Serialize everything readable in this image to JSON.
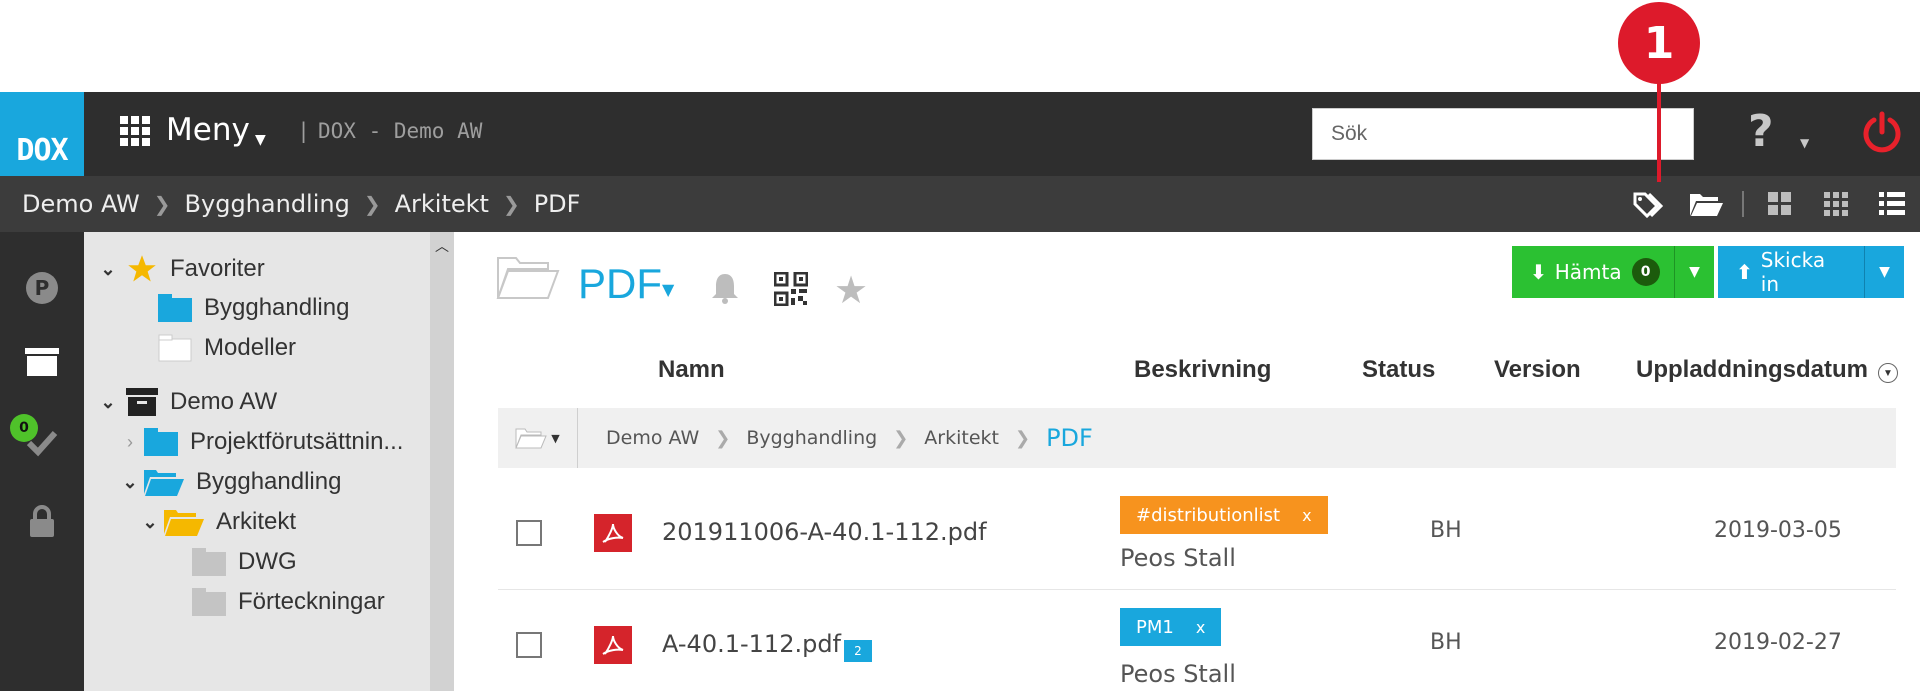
{
  "callout": {
    "number": "1"
  },
  "header": {
    "logo": "DOX",
    "menu_label": "Meny",
    "separator": "|",
    "site_title": "DOX - Demo AW",
    "search_placeholder": "Sök",
    "help_symbol": "?"
  },
  "breadcrumb": [
    "Demo AW",
    "Bygghandling",
    "Arkitekt",
    "PDF"
  ],
  "rail": {
    "task_badge": "0"
  },
  "tree": {
    "favorites_label": "Favoriter",
    "favorites": [
      "Bygghandling",
      "Modeller"
    ],
    "project_label": "Demo AW",
    "items": [
      "Projektförutsättnin...",
      "Bygghandling",
      "Arkitekt",
      "DWG",
      "Förteckningar"
    ]
  },
  "content": {
    "folder_title": "PDF",
    "download": {
      "label": "Hämta",
      "count": "0"
    },
    "upload": {
      "label": "Skicka in"
    },
    "columns": {
      "name": "Namn",
      "description": "Beskrivning",
      "status": "Status",
      "version": "Version",
      "upload_date": "Uppladdningsdatum"
    },
    "path": [
      "Demo AW",
      "Bygghandling",
      "Arkitekt",
      "PDF"
    ],
    "files": [
      {
        "name": "201911006-A-40.1-112.pdf",
        "tag": "#distributionlist",
        "tag_close": "x",
        "tag_color": "#f7931e",
        "description": "Peos Stall",
        "version": "BH",
        "date": "2019-03-05",
        "comments": ""
      },
      {
        "name": "A-40.1-112.pdf",
        "tag": "PM1",
        "tag_close": "x",
        "tag_color": "#19a7dd",
        "description": "Peos Stall",
        "version": "BH",
        "date": "2019-02-27",
        "comments": "2"
      }
    ]
  },
  "colors": {
    "accent": "#19a7dd",
    "callout": "#dd1a2b",
    "download": "#2bc132",
    "pdf": "#d5242b"
  }
}
